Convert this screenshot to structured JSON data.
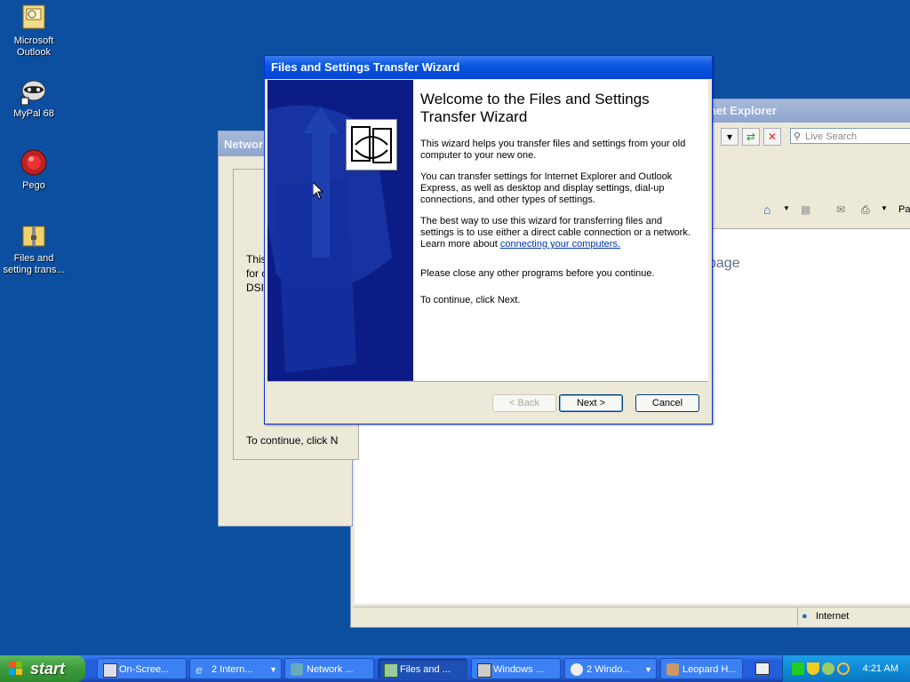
{
  "desktop": {
    "icons": [
      {
        "label": "Microsoft Outlook",
        "icon": "outlook-icon"
      },
      {
        "label": "MyPal 68",
        "icon": "raccoon-icon"
      },
      {
        "label": "Pego",
        "icon": "pego-icon"
      },
      {
        "label": "Files and setting trans...",
        "icon": "zip-folder-icon"
      }
    ]
  },
  "ie_window": {
    "title": "rnet Explorer",
    "search_placeholder": "Live Search",
    "page_text": "page",
    "status_zone": "Internet",
    "toolbar_page": "Pa"
  },
  "network_window": {
    "title": "Network",
    "text1": "This",
    "text2": "for c",
    "text3": "DSI",
    "text4": "To continue, click N"
  },
  "wizard": {
    "title": "Files and Settings Transfer Wizard",
    "heading": "Welcome to the Files and Settings Transfer Wizard",
    "p1": "This wizard helps you transfer files and settings from your old computer to your new one.",
    "p2": "You can transfer settings for Internet Explorer and Outlook Express, as well as desktop and display settings, dial-up connections, and other types of settings.",
    "p3_prefix": "The best way to use this wizard for transferring files and settings is to use either a direct cable connection or a network. Learn more about ",
    "p3_link": "connecting your computers.",
    "p4": "Please close any other programs before you continue.",
    "p5": "To continue, click Next.",
    "buttons": {
      "back": "< Back",
      "next": "Next >",
      "cancel": "Cancel"
    }
  },
  "taskbar": {
    "start_label": "start",
    "tasks": [
      {
        "label": "On-Scree..."
      },
      {
        "label": "2 Intern..."
      },
      {
        "label": "Network ..."
      },
      {
        "label": "Files and ..."
      },
      {
        "label": "Windows ..."
      },
      {
        "label": "2 Windo..."
      },
      {
        "label": "Leopard H..."
      }
    ],
    "clock": "4:21 AM"
  }
}
